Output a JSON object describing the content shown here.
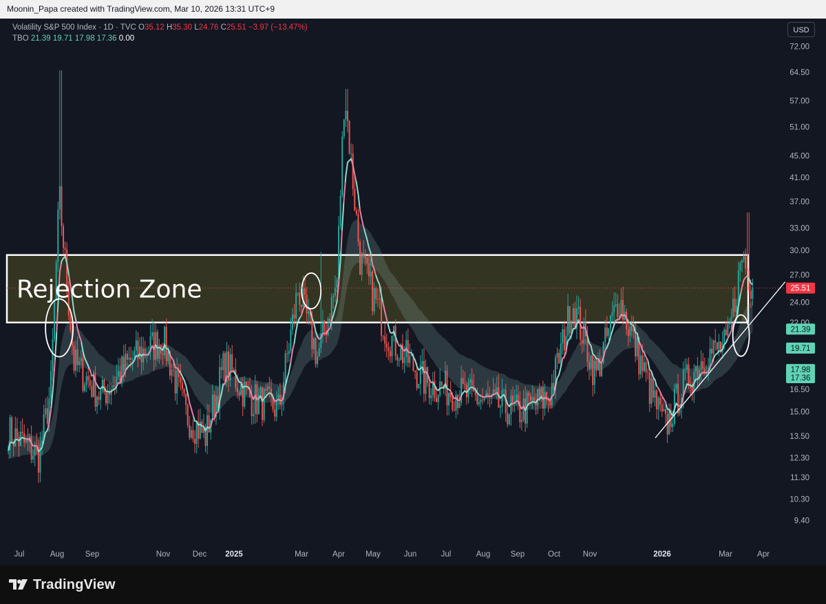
{
  "attribution": "Moonin_Papa created with TradingView.com, Mar 10, 2026 13:31 UTC+9",
  "legend": {
    "symbol": "Volatility S&P 500 Index · 1D · TVC",
    "o_label": "O",
    "o_value": "35.12",
    "h_label": "H",
    "h_value": "35.30",
    "l_label": "L",
    "l_value": "24.76",
    "c_label": "C",
    "c_value": "25.51",
    "change": "−3.97 (−13.47%)",
    "indicator": "TBO",
    "indicator_values": [
      "21.39",
      "19.71",
      "17.98",
      "17.36"
    ],
    "indicator_extra": "0.00"
  },
  "currency_button": "USD",
  "brand": "TradingView",
  "annotation": "Rejection Zone",
  "colors": {
    "bull": "#26a69a",
    "bear": "#ef5350",
    "fast_line": "#7ee8d0",
    "slow_line": "#f48fb1",
    "zone_fill": "#3b3a22",
    "price_label_bg": "#f23645",
    "indicator_label_bg": "#5fd3b6"
  },
  "chart_data": {
    "type": "candlestick",
    "scale": "log",
    "y_ticks": [
      "72.00",
      "64.50",
      "57.00",
      "51.00",
      "45.00",
      "41.00",
      "37.00",
      "33.00",
      "30.00",
      "27.00",
      "24.00",
      "22.00",
      "16.50",
      "15.00",
      "13.50",
      "12.30",
      "11.30",
      "10.30",
      "9.40"
    ],
    "x_ticks": [
      "Jul",
      "Aug",
      "Sep",
      "Nov",
      "Dec",
      "2025",
      "Mar",
      "Apr",
      "May",
      "Jun",
      "Jul",
      "Aug",
      "Sep",
      "Oct",
      "Nov",
      "2026",
      "Mar",
      "Apr"
    ],
    "x_ticks_bold": [
      "2025",
      "2026"
    ],
    "price_labels": [
      {
        "value": "25.51",
        "kind": "last"
      },
      {
        "value": "21.39",
        "kind": "indicator"
      },
      {
        "value": "19.71",
        "kind": "indicator"
      },
      {
        "value": "17.98",
        "kind": "indicator"
      },
      {
        "value": "17.36",
        "kind": "indicator"
      }
    ],
    "rejection_zone": {
      "low": 22.0,
      "high": 29.4,
      "label": "Rejection Zone"
    },
    "series_anchors": [
      {
        "t": 0,
        "close": 13.8
      },
      {
        "t": 0.04,
        "close": 12.4
      },
      {
        "t": 0.055,
        "close": 16.5
      },
      {
        "t": 0.066,
        "close": 38.0
      },
      {
        "t": 0.085,
        "close": 18.5
      },
      {
        "t": 0.12,
        "close": 16.0
      },
      {
        "t": 0.16,
        "close": 18.8
      },
      {
        "t": 0.2,
        "close": 20.5
      },
      {
        "t": 0.23,
        "close": 14.8
      },
      {
        "t": 0.255,
        "close": 13.5
      },
      {
        "t": 0.28,
        "close": 18.5
      },
      {
        "t": 0.31,
        "close": 16.0
      },
      {
        "t": 0.35,
        "close": 15.2
      },
      {
        "t": 0.375,
        "close": 25.5
      },
      {
        "t": 0.4,
        "close": 19.0
      },
      {
        "t": 0.425,
        "close": 26.0
      },
      {
        "t": 0.435,
        "close": 60.0
      },
      {
        "t": 0.455,
        "close": 29.0
      },
      {
        "t": 0.49,
        "close": 21.0
      },
      {
        "t": 0.54,
        "close": 17.0
      },
      {
        "t": 0.6,
        "close": 16.0
      },
      {
        "t": 0.66,
        "close": 15.0
      },
      {
        "t": 0.7,
        "close": 16.0
      },
      {
        "t": 0.73,
        "close": 24.0
      },
      {
        "t": 0.76,
        "close": 17.5
      },
      {
        "t": 0.79,
        "close": 24.5
      },
      {
        "t": 0.83,
        "close": 16.5
      },
      {
        "t": 0.85,
        "close": 14.0
      },
      {
        "t": 0.87,
        "close": 16.5
      },
      {
        "t": 0.9,
        "close": 19.0
      },
      {
        "t": 0.93,
        "close": 20.0
      },
      {
        "t": 0.95,
        "close": 29.5
      },
      {
        "t": 0.963,
        "close": 25.51
      }
    ],
    "spikes": [
      {
        "t": 0.068,
        "high": 65.0
      },
      {
        "t": 0.405,
        "high": 29.8
      },
      {
        "t": 0.438,
        "high": 60.0
      },
      {
        "t": 0.957,
        "high": 35.3
      }
    ],
    "indicator_last": {
      "fast": 21.39,
      "mid": 19.71,
      "slow": 17.98,
      "base": 17.36
    }
  }
}
